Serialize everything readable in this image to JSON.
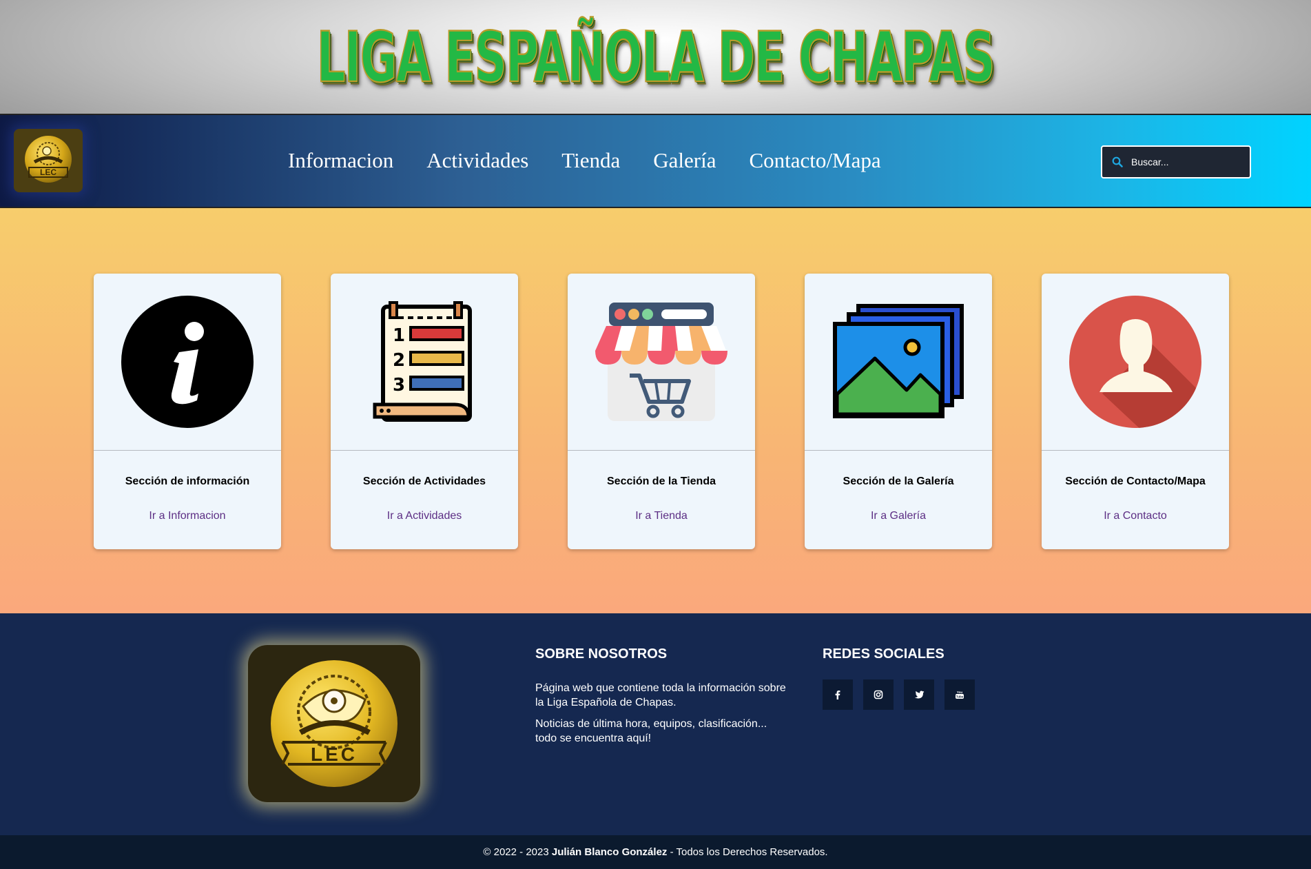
{
  "banner": {
    "title": "LIGA ESPAÑOLA DE CHAPAS"
  },
  "nav": {
    "logo_text": "LEC",
    "links": [
      "Informacion",
      "Actividades",
      "Tienda",
      "Galería",
      "Contacto/Mapa"
    ],
    "search_placeholder": "Buscar..."
  },
  "cards": [
    {
      "title": "Sección de información",
      "link": "Ir a Informacion",
      "icon": "info-icon"
    },
    {
      "title": "Sección de Actividades",
      "link": "Ir a Actividades",
      "icon": "ranking-board-icon"
    },
    {
      "title": "Sección de la Tienda",
      "link": "Ir a Tienda",
      "icon": "shop-icon"
    },
    {
      "title": "Sección de la Galería",
      "link": "Ir a Galería",
      "icon": "gallery-icon"
    },
    {
      "title": "Sección de Contacto/Mapa",
      "link": "Ir a Contacto",
      "icon": "contact-user-icon"
    }
  ],
  "footer": {
    "logo_text": "LEC",
    "about_title": "SOBRE NOSOTROS",
    "about_p1": "Página web que contiene toda la información sobre la Liga Española de Chapas.",
    "about_p2": "Noticias de última hora, equipos, clasificación... todo se encuentra aquí!",
    "social_title": "REDES SOCIALES",
    "social": [
      "facebook-icon",
      "instagram-icon",
      "twitter-icon",
      "youtube-icon"
    ]
  },
  "copyright": {
    "prefix": "© 2022 - 2023 ",
    "author": "Julián Blanco González",
    "suffix": " - Todos los Derechos Reservados."
  },
  "colors": {
    "banner_green": "#23b845",
    "nav_start": "#0e1a45",
    "nav_end": "#00d3ff",
    "main_top": "#f7cd6c",
    "main_bottom": "#faa87c",
    "card_bg": "#eff6fc",
    "link": "#5c2e84",
    "footer": "#152850",
    "bottom_bar": "#0b1a2e",
    "gold": "#e2b722"
  }
}
